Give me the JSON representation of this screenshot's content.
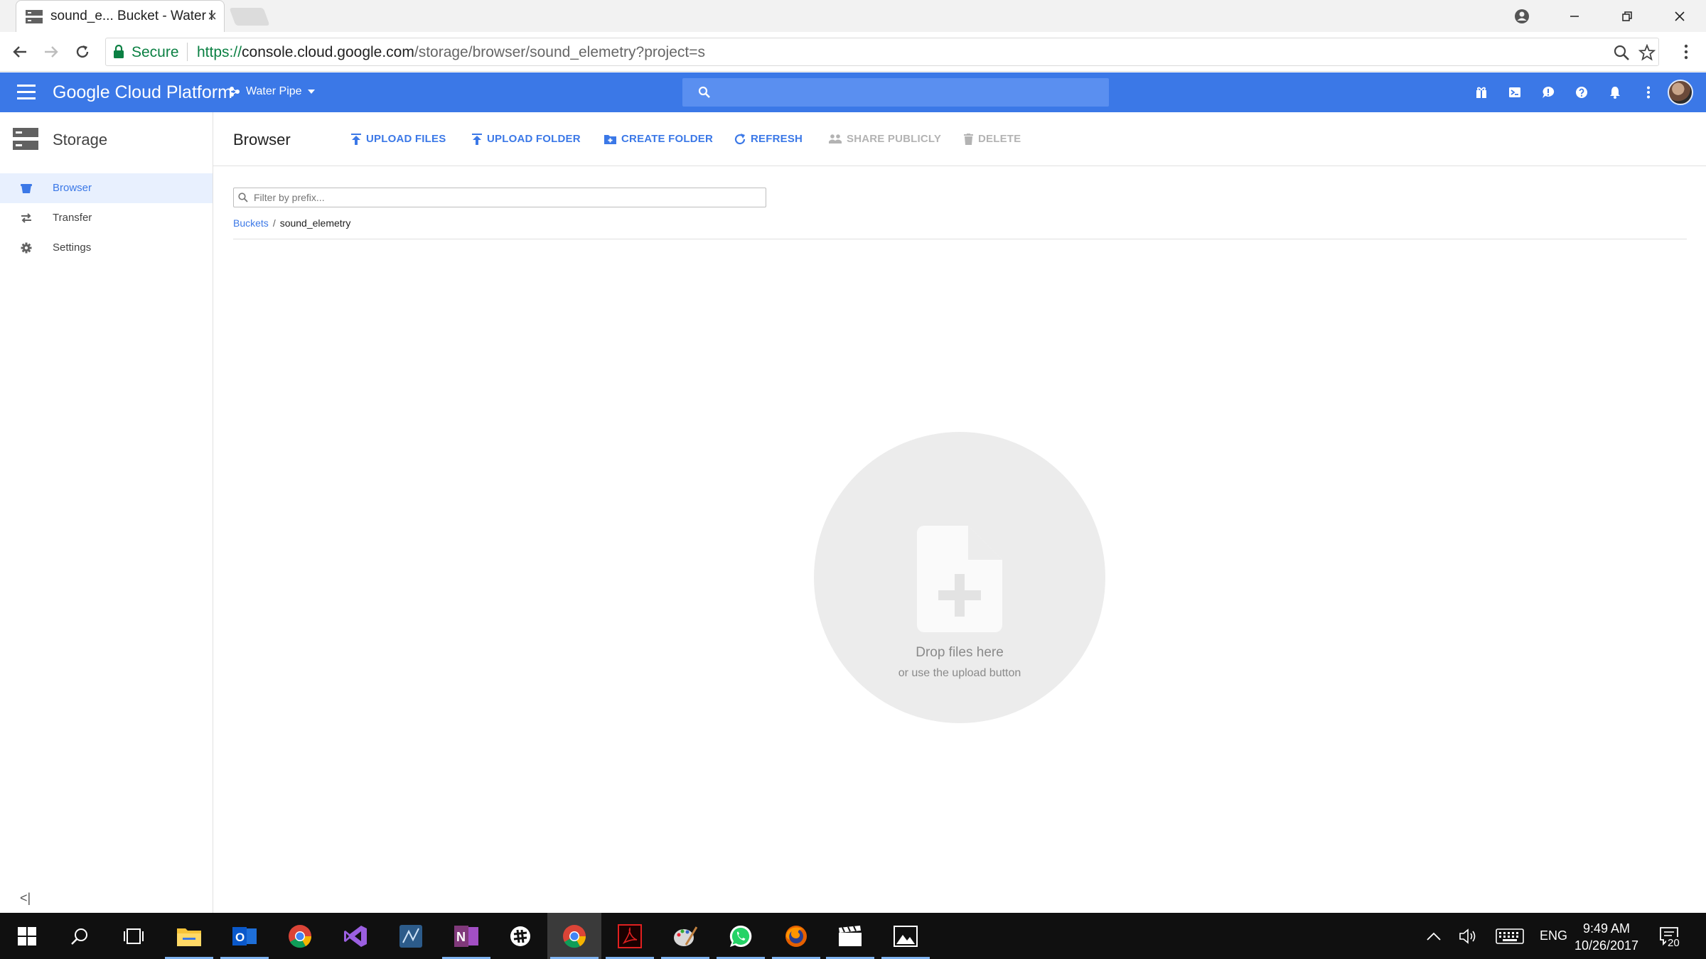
{
  "browser": {
    "tab_title": "sound_e... Bucket - Water Pipe",
    "tab_close": "×",
    "secure_label": "Secure",
    "url_scheme": "https://",
    "url_host": "console.cloud.google.com",
    "url_path": "/storage/browser/sound_elemetry?project=s"
  },
  "gcp": {
    "brand": "Google Cloud Platform",
    "project": "Water Pipe",
    "accent": "#3b78e7"
  },
  "sidebar": {
    "title": "Storage",
    "items": [
      {
        "label": "Browser",
        "icon": "bucket-icon",
        "active": true
      },
      {
        "label": "Transfer",
        "icon": "transfer-icon",
        "active": false
      },
      {
        "label": "Settings",
        "icon": "gear-icon",
        "active": false
      }
    ],
    "collapse_glyph": "<|"
  },
  "toolbar": {
    "title": "Browser",
    "upload_files": "UPLOAD FILES",
    "upload_folder": "UPLOAD FOLDER",
    "create_folder": "CREATE FOLDER",
    "refresh": "REFRESH",
    "share_publicly": "SHARE PUBLICLY",
    "delete": "DELETE"
  },
  "filter": {
    "placeholder": "Filter by prefix..."
  },
  "breadcrumb": {
    "root": "Buckets",
    "separator": "/",
    "current": "sound_elemetry"
  },
  "dropzone": {
    "title": "Drop files here",
    "subtitle": "or use the upload button"
  },
  "taskbar": {
    "language": "ENG",
    "time": "9:49 AM",
    "date": "10/26/2017",
    "notification_count": "20"
  }
}
